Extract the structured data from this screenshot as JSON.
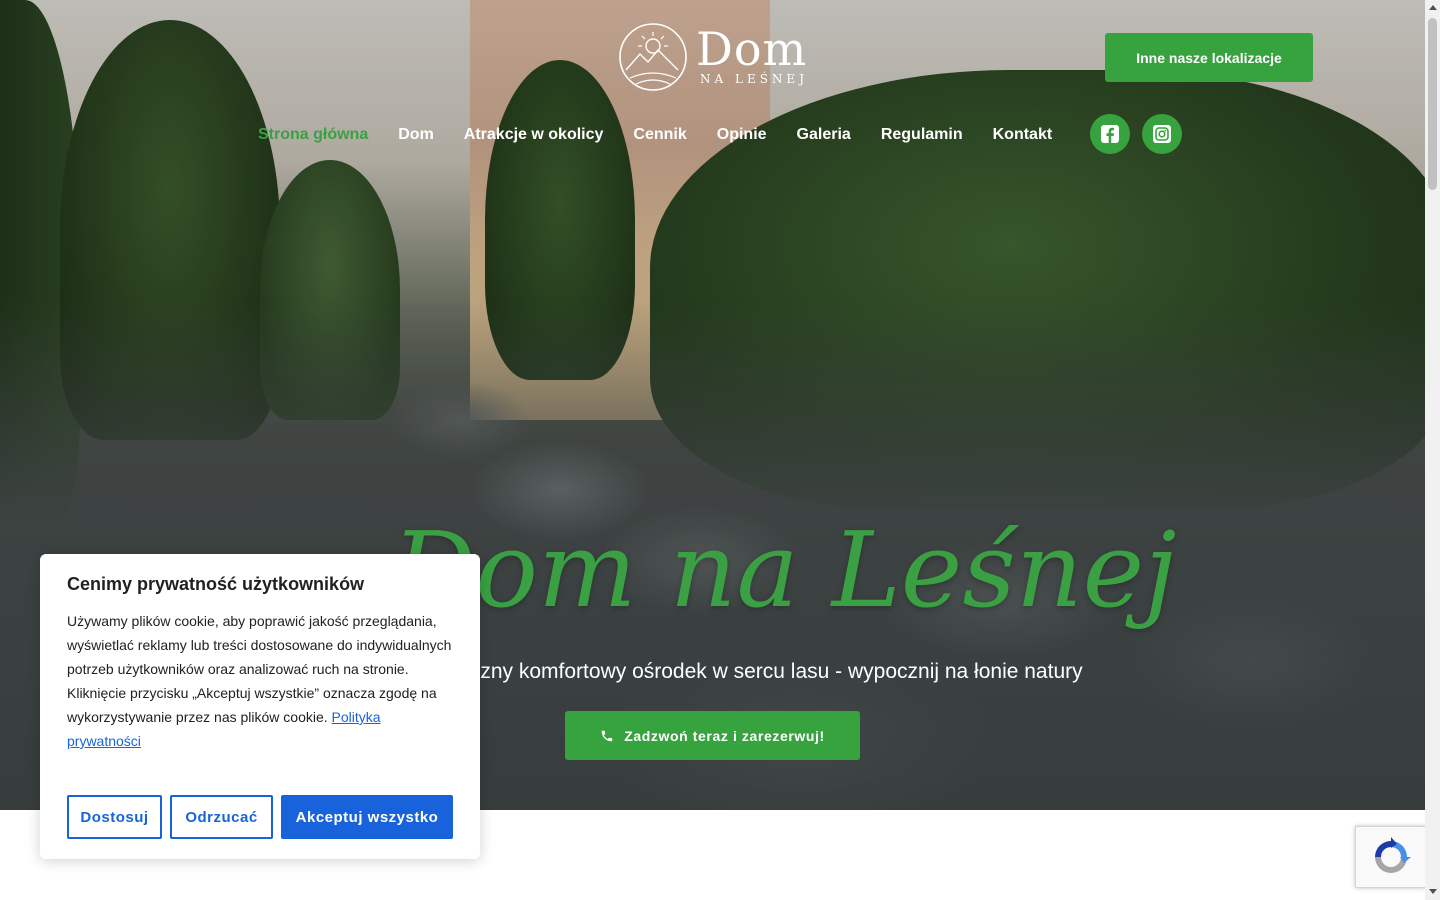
{
  "brand": {
    "name": "Dom",
    "subtitle": "NA LEŚNEJ"
  },
  "header": {
    "locations_button": "Inne nasze lokalizacje"
  },
  "nav": {
    "items": [
      {
        "label": "Strona główna",
        "active": true
      },
      {
        "label": "Dom"
      },
      {
        "label": "Atrakcje w okolicy"
      },
      {
        "label": "Cennik"
      },
      {
        "label": "Opinie"
      },
      {
        "label": "Galeria"
      },
      {
        "label": "Regulamin"
      },
      {
        "label": "Kontakt"
      }
    ],
    "social": [
      {
        "icon": "facebook-icon"
      },
      {
        "icon": "instagram-icon"
      }
    ]
  },
  "hero": {
    "title": "Dom na Leśnej",
    "subtitle": "Całoroczny komfortowy ośrodek w sercu lasu - wypocznij na łonie natury",
    "cta": "Zadzwoń teraz i zarezerwuj!",
    "cta_icon": "phone-icon"
  },
  "cookie": {
    "title": "Cenimy prywatność użytkowników",
    "text": "Używamy plików cookie, aby poprawić jakość przeglądania, wyświetlać reklamy lub treści dostosowane do indywidualnych potrzeb użytkowników oraz analizować ruch na stronie. Kliknięcie przycisku „Akceptuj wszystkie” oznacza zgodę na wykorzystywanie przez nas plików cookie.",
    "link": "Polityka prywatności",
    "buttons": {
      "customize": "Dostosuj",
      "reject": "Odrzucać",
      "accept": "Akceptuj wszystko"
    }
  },
  "colors": {
    "brand_green": "#37a33f",
    "cookie_blue": "#1863dc"
  }
}
